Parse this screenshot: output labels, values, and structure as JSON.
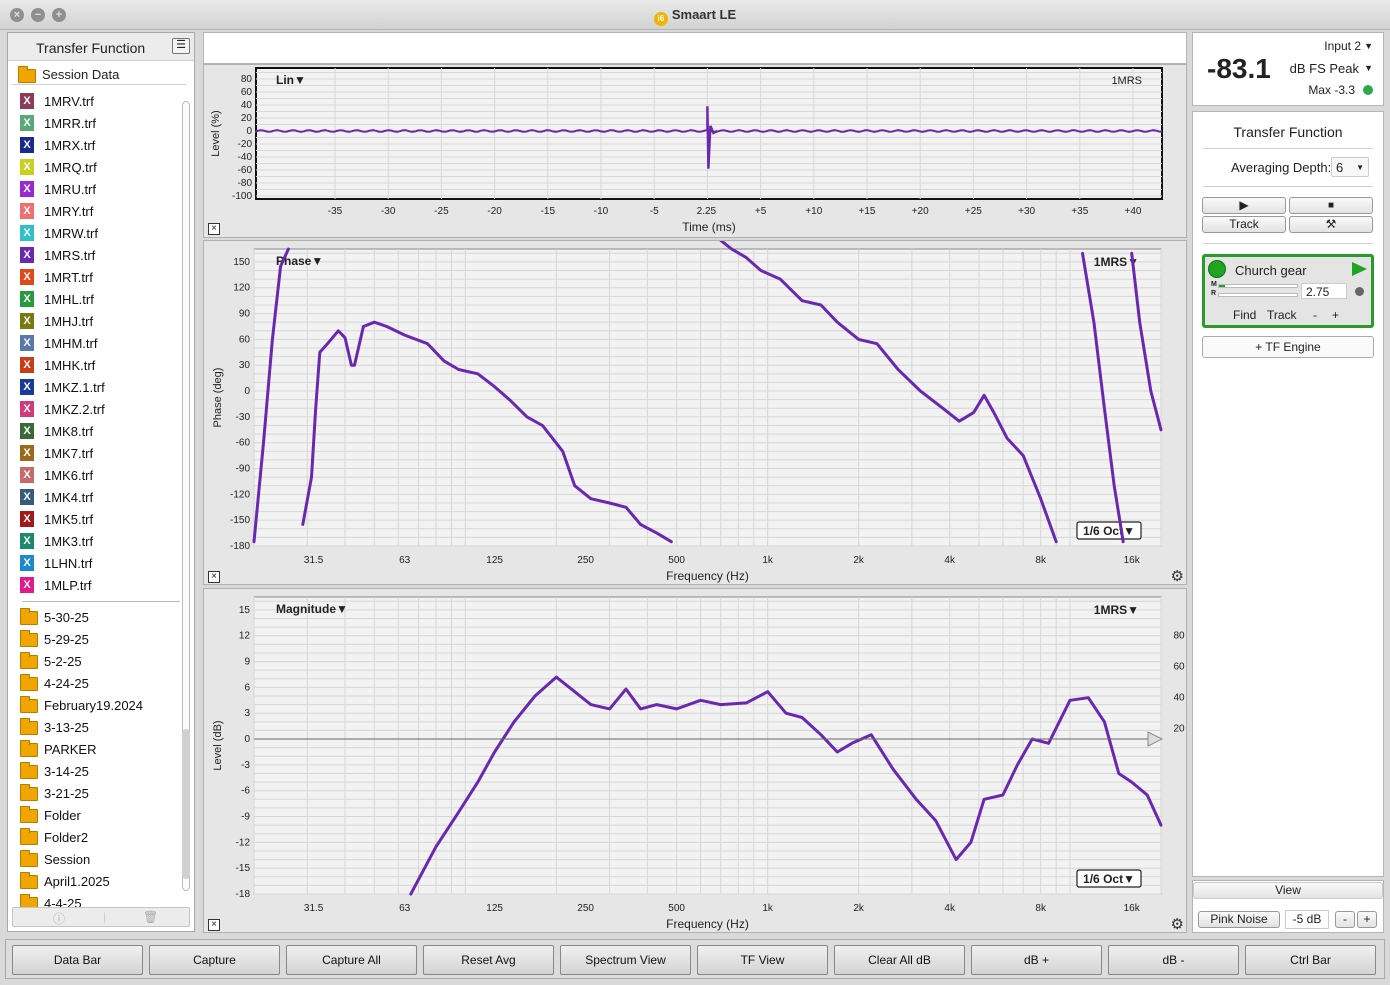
{
  "window": {
    "title": "Smaart LE"
  },
  "left_panel": {
    "title": "Transfer Function",
    "session_label": "Session Data",
    "files": [
      {
        "name": "1MRV.trf",
        "color": "#8e3a5a"
      },
      {
        "name": "1MRR.trf",
        "color": "#5aa87a"
      },
      {
        "name": "1MRX.trf",
        "color": "#1a2a8c"
      },
      {
        "name": "1MRQ.trf",
        "color": "#c8d020"
      },
      {
        "name": "1MRU.trf",
        "color": "#9a2ad0"
      },
      {
        "name": "1MRY.trf",
        "color": "#f07070"
      },
      {
        "name": "1MRW.trf",
        "color": "#30c0c8"
      },
      {
        "name": "1MRS.trf",
        "color": "#6a28b0"
      },
      {
        "name": "1MRT.trf",
        "color": "#e04a1a"
      },
      {
        "name": "1MHL.trf",
        "color": "#2a9a40"
      },
      {
        "name": "1MHJ.trf",
        "color": "#7a7a10"
      },
      {
        "name": "1MHM.trf",
        "color": "#5a78a8"
      },
      {
        "name": "1MHK.trf",
        "color": "#c83c1a"
      },
      {
        "name": "1MKZ.1.trf",
        "color": "#1a3a9a"
      },
      {
        "name": "1MKZ.2.trf",
        "color": "#d03a7a"
      },
      {
        "name": "1MK8.trf",
        "color": "#3a6a3a"
      },
      {
        "name": "1MK7.trf",
        "color": "#9a6a1a"
      },
      {
        "name": "1MK6.trf",
        "color": "#c86a6a"
      },
      {
        "name": "1MK4.trf",
        "color": "#3a5a7a"
      },
      {
        "name": "1MK5.trf",
        "color": "#a01a1a"
      },
      {
        "name": "1MK3.trf",
        "color": "#1a8a6a"
      },
      {
        "name": "1LHN.trf",
        "color": "#1a8ad0"
      },
      {
        "name": "1MLP.trf",
        "color": "#e01a8a"
      }
    ],
    "folders": [
      "5-30-25",
      "5-29-25",
      "5-2-25",
      "4-24-25",
      "February19.2024",
      "3-13-25",
      "PARKER",
      "3-14-25",
      "3-21-25",
      "Folder",
      "Folder2",
      "Session",
      "April1.2025",
      "4-4-25"
    ]
  },
  "impulse_plot": {
    "title": "Lin▼",
    "trace_label": "1MRS",
    "y_label": "Level (%)",
    "x_label": "Time (ms)",
    "y_ticks": [
      "80",
      "60",
      "40",
      "20",
      "0",
      "-20",
      "-40",
      "-60",
      "-80",
      "-100"
    ],
    "x_ticks": [
      "-35",
      "-30",
      "-25",
      "-20",
      "-15",
      "-10",
      "-5",
      "2.25",
      "+5",
      "+10",
      "+15",
      "+20",
      "+25",
      "+30",
      "+35",
      "+40"
    ]
  },
  "phase_plot": {
    "title": "Phase▼",
    "trace_label": "1MRS▼",
    "y_label": "Phase (deg)",
    "x_label": "Frequency (Hz)",
    "y_ticks": [
      "150",
      "120",
      "90",
      "60",
      "30",
      "0",
      "-30",
      "-60",
      "-90",
      "-120",
      "-150",
      "-180"
    ],
    "x_ticks": [
      "31.5",
      "63",
      "125",
      "250",
      "500",
      "1k",
      "2k",
      "4k",
      "8k",
      "16k"
    ],
    "smoothing": "1/6 Oct▼"
  },
  "magnitude_plot": {
    "title": "Magnitude▼",
    "trace_label": "1MRS▼",
    "y_label": "Level (dB)",
    "x_label": "Frequency (Hz)",
    "y_ticks": [
      "15",
      "12",
      "9",
      "6",
      "3",
      "0",
      "-3",
      "-6",
      "-9",
      "-12",
      "-15",
      "-18"
    ],
    "y2_ticks": [
      "80",
      "60",
      "40",
      "20"
    ],
    "x_ticks": [
      "31.5",
      "63",
      "125",
      "250",
      "500",
      "1k",
      "2k",
      "4k",
      "8k",
      "16k"
    ],
    "smoothing": "1/6 Oct▼"
  },
  "meter": {
    "input": "Input 2",
    "value": "-83.1",
    "mode": "dB FS Peak",
    "max": "Max -3.3"
  },
  "tf_panel": {
    "title": "Transfer Function",
    "averaging_label": "Averaging Depth:",
    "averaging_value": "6",
    "track_label": "Track",
    "engine_name": "Church gear",
    "delay_value": "2.75",
    "meter_m": "M",
    "meter_r": "R",
    "find_label": "Find",
    "track2_label": "Track",
    "minus": "-",
    "plus": "+",
    "add_engine": "+ TF Engine"
  },
  "view_panel": {
    "view_label": "View",
    "pink_noise": "Pink Noise",
    "noise_level": "-5 dB",
    "minus": "-",
    "plus": "+"
  },
  "bottom_bar": [
    "Data Bar",
    "Capture",
    "Capture All",
    "Reset Avg",
    "Spectrum View",
    "TF View",
    "Clear All dB",
    "dB +",
    "dB -",
    "Ctrl Bar"
  ],
  "colors": {
    "trace": "#6a28b0",
    "engine_green": "#2a9a2a"
  }
}
